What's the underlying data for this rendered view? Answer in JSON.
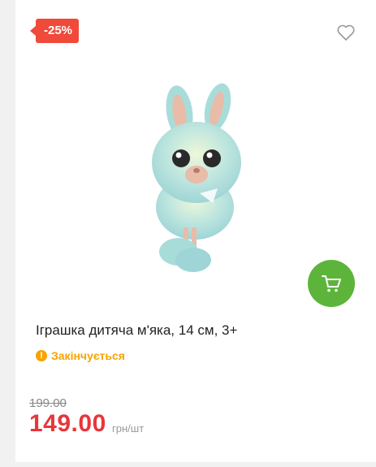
{
  "product": {
    "discount_badge": "-25%",
    "title": "Іграшка дитяча м'яка, 14 см, 3+",
    "status": "Закінчується",
    "old_price": "199.00",
    "price": "149.00",
    "unit": "грн/шт"
  },
  "icons": {
    "favorite": "heart-outline-icon",
    "cart": "cart-icon",
    "status": "warning-icon"
  },
  "colors": {
    "badge": "#f04a3a",
    "cart_button": "#5db43a",
    "status": "#f7a400",
    "price": "#e8363a"
  }
}
